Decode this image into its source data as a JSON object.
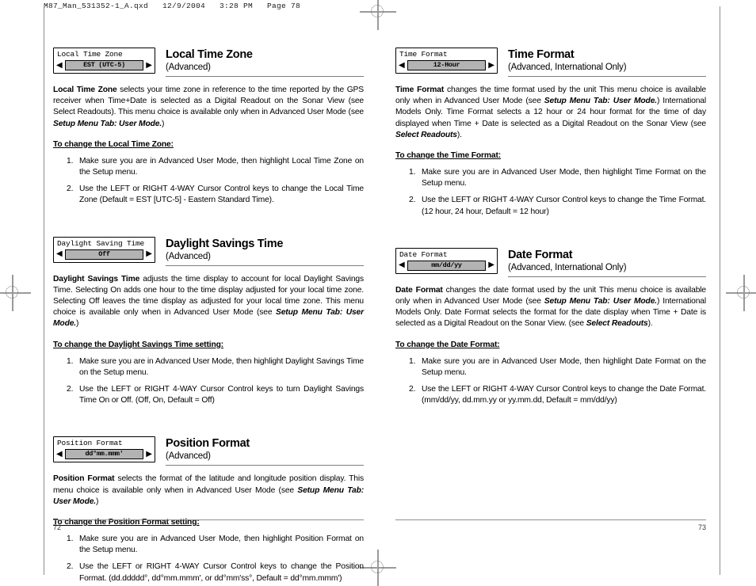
{
  "prepress": {
    "header": "M87_Man_531352-1_A.qxd   12/9/2004   3:28 PM   Page 78",
    "registration_icon": "registration-mark-icon"
  },
  "left_page": {
    "page_number": "72",
    "sections": [
      {
        "lcd": {
          "title": "Local Time Zone",
          "value": "EST (UTC-5)",
          "left_arrow": "◀",
          "right_arrow": "▶"
        },
        "title": "Local Time Zone",
        "subtitle": "(Advanced)",
        "body_lead": "Local Time Zone",
        "body_text": " selects your time zone in reference to the time reported by the GPS receiver when Time+Date is selected as a Digital Readout on the Sonar View (see Select Readouts).  This menu choice is available only when in Advanced User Mode (see ",
        "body_emph": "Setup Menu Tab: User Mode.",
        "body_tail": ")",
        "howto": "To change the Local Time Zone:",
        "steps": [
          "Make sure you are in Advanced User Mode, then highlight Local Time Zone on the Setup menu.",
          "Use the LEFT or RIGHT 4-WAY Cursor Control keys to change the Local Time Zone (Default = EST [UTC-5] - Eastern Standard Time)."
        ]
      },
      {
        "lcd": {
          "title": "Daylight Saving Time",
          "value": "Off",
          "left_arrow": "◀",
          "right_arrow": "▶"
        },
        "title": "Daylight Savings Time",
        "subtitle": "(Advanced)",
        "body_lead": "Daylight Savings Time",
        "body_text": " adjusts the time display to account for local Daylight Savings Time. Selecting On adds one hour to the time display adjusted for your local time zone.  Selecting Off leaves the time display as adjusted for your local time zone. This menu choice is available only when in Advanced User Mode (see ",
        "body_emph": "Setup Menu Tab: User Mode.",
        "body_tail": ")",
        "howto": "To change the Daylight Savings Time setting:",
        "steps": [
          "Make sure you are in Advanced User Mode, then highlight Daylight Savings Time on the Setup menu.",
          "Use the LEFT or RIGHT 4-WAY Cursor Control keys to turn Daylight Savings Time On or Off. (Off, On, Default = Off)"
        ]
      },
      {
        "lcd": {
          "title": "Position Format",
          "value": "dd°mm.mmm'",
          "left_arrow": "◀",
          "right_arrow": "▶"
        },
        "title": "Position Format",
        "subtitle": "(Advanced)",
        "body_lead": "Position Format",
        "body_text": " selects the format of the latitude and longitude position display.   This menu choice is available only when in Advanced User Mode (see ",
        "body_emph": "Setup Menu Tab: User Mode.",
        "body_tail": ")",
        "howto": "To change the Position Format setting:",
        "steps": [
          "Make sure you are in Advanced User Mode, then highlight Position Format on the Setup menu.",
          "Use the LEFT or RIGHT 4-WAY Cursor Control keys to change the Position Format. (dd.ddddd°, dd°mm.mmm', or dd°mm'ss°, Default = dd°mm.mmm')"
        ]
      }
    ]
  },
  "right_page": {
    "page_number": "73",
    "sections": [
      {
        "lcd": {
          "title": "Time Format",
          "value": "12-Hour",
          "left_arrow": "◀",
          "right_arrow": "▶"
        },
        "title": "Time Format",
        "subtitle": "(Advanced, International Only)",
        "body_lead": "Time Format",
        "body_text": " changes the time format used by the unit  This menu choice is available only when in Advanced User Mode (see ",
        "body_emph": "Setup Menu Tab: User Mode.",
        "body_tail": ") International Models Only. Time Format selects a 12 hour or 24 hour format for the time of day displayed when Time + Date is selected as a Digital Readout on the Sonar View (see ",
        "body_emph2": "Select Readouts",
        "body_tail2": ").",
        "howto": "To change the Time Format:",
        "steps": [
          "Make sure you are in Advanced User Mode, then highlight Time Format on the Setup menu.",
          "Use the LEFT or RIGHT 4-WAY Cursor Control keys to change the Time Format. (12 hour, 24 hour, Default = 12 hour)"
        ]
      },
      {
        "lcd": {
          "title": "Date Format",
          "value": "mm/dd/yy",
          "left_arrow": "◀",
          "right_arrow": "▶"
        },
        "title": "Date Format",
        "subtitle": "(Advanced, International Only)",
        "body_lead": "Date Format",
        "body_text": " changes the date format used by the unit  This menu choice is available only when in Advanced User Mode (see ",
        "body_emph": "Setup Menu Tab: User Mode.",
        "body_tail": ")  International Models Only. Date Format selects the format for the date display when Time + Date is selected as a Digital Readout on the Sonar View. (see ",
        "body_emph2": "Select Readouts",
        "body_tail2": ").",
        "howto": "To change the Date Format:",
        "steps": [
          "Make sure you are in Advanced User Mode, then highlight Date Format on the Setup menu.",
          "Use the LEFT or RIGHT 4-WAY Cursor Control keys to change the Date Format. (mm/dd/yy, dd.mm.yy or yy.mm.dd, Default = mm/dd/yy)"
        ]
      }
    ]
  }
}
